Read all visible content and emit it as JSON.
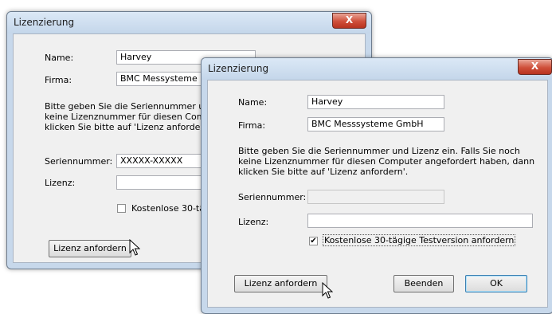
{
  "back_dialog": {
    "title": "Lizenzierung",
    "close_label": "X",
    "name_label": "Name:",
    "name_value": "Harvey",
    "firma_label": "Firma:",
    "firma_value": "BMC Messysteme",
    "instructions": [
      "Bitte geben Sie die Seriennummer un",
      "keine Lizenznummer für diesen Comp",
      "klicken Sie bitte auf 'Lizenz anforderr"
    ],
    "serial_label": "Seriennummer:",
    "serial_value": "XXXXX-XXXXX",
    "license_label": "Lizenz:",
    "license_value": "",
    "trial_label": "Kostenlose 30-tä",
    "request_button": "Lizenz anfordern"
  },
  "front_dialog": {
    "title": "Lizenzierung",
    "close_label": "X",
    "name_label": "Name:",
    "name_value": "Harvey",
    "firma_label": "Firma:",
    "firma_value": "BMC Messsysteme GmbH",
    "instructions": [
      "Bitte geben Sie die Seriennummer und Lizenz ein. Falls Sie noch",
      "keine Lizenznummer für diesen Computer angefordert haben, dann",
      "klicken Sie bitte auf 'Lizenz anfordern'."
    ],
    "serial_label": "Seriennummer:",
    "serial_value": "",
    "license_label": "Lizenz:",
    "license_value": "",
    "trial_checked": true,
    "trial_mark": "✔",
    "trial_label": "Kostenlose 30-tägige Testversion anfordern",
    "request_button": "Lizenz anfordern",
    "exit_button": "Beenden",
    "ok_button": "OK"
  }
}
